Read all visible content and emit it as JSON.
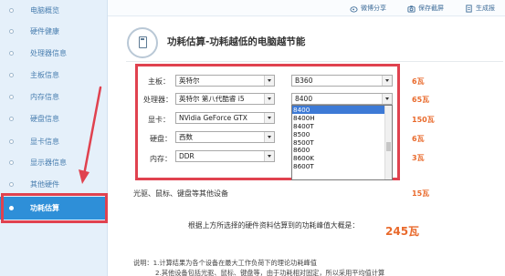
{
  "sidebar": {
    "items": [
      {
        "label": "电脑概览"
      },
      {
        "label": "硬件健康"
      },
      {
        "label": "处理器信息"
      },
      {
        "label": "主板信息"
      },
      {
        "label": "内存信息"
      },
      {
        "label": "硬盘信息"
      },
      {
        "label": "显卡信息"
      },
      {
        "label": "显示器信息"
      },
      {
        "label": "其他硬件"
      },
      {
        "label": "功耗估算"
      }
    ],
    "active_index": 9
  },
  "toolbar": {
    "share_label": "微博分享",
    "save_label": "保存截屏",
    "report_label": "生成报"
  },
  "header": {
    "title": "功耗估算-功耗越低的电脑越节能"
  },
  "form": {
    "rows": [
      {
        "label": "主板：",
        "brand": "英特尔",
        "model": "B360",
        "watt": "6瓦"
      },
      {
        "label": "处理器：",
        "brand": "英特尔 第八代酷睿 i5",
        "model": "8400",
        "watt": "65瓦"
      },
      {
        "label": "显卡：",
        "brand": "NVidia GeForce GTX",
        "model": "",
        "watt": "150瓦"
      },
      {
        "label": "硬盘：",
        "brand": "西数",
        "model": "",
        "watt": "6瓦"
      },
      {
        "label": "内存：",
        "brand": "DDR",
        "model": "",
        "watt": "3瓦"
      }
    ],
    "dropdown_options": [
      "8400",
      "8400H",
      "8400T",
      "8500",
      "8500T",
      "8600",
      "8600K",
      "8600T"
    ],
    "dropdown_selected": 0,
    "misc": {
      "label": "光驱、鼠标、键盘等其他设备",
      "watt": "15瓦"
    }
  },
  "summary": {
    "text": "根据上方所选择的硬件资料估算到的功耗峰值大概是：",
    "value": "245瓦"
  },
  "notes": [
    "说明：1.计算结果为各个设备在最大工作负荷下的理论功耗峰值",
    "2.其他设备包括光驱、鼠标、键盘等，由于功耗相对固定，所以采用平均值计算"
  ],
  "colors": {
    "accent": "#2e8fd8",
    "highlight_red": "#e0424f",
    "watt_orange": "#e96a2c"
  }
}
